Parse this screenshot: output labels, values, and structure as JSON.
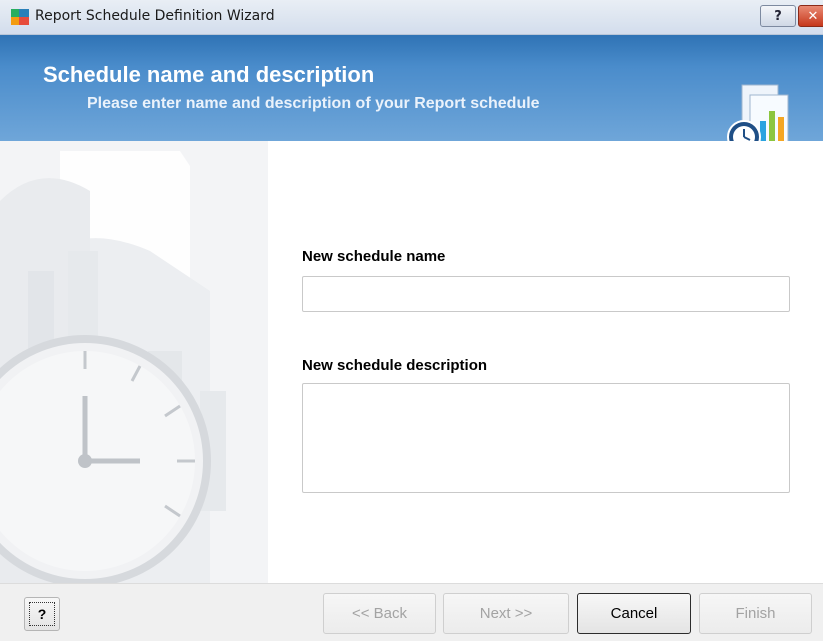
{
  "window": {
    "title": "Report Schedule Definition Wizard",
    "help_glyph": "?",
    "close_glyph": "✕"
  },
  "header": {
    "title": "Schedule name and description",
    "subtitle": "Please enter name and description of your Report schedule"
  },
  "form": {
    "name_label": "New schedule name",
    "name_value": "",
    "description_label": "New schedule description",
    "description_value": ""
  },
  "footer": {
    "help_label": "?",
    "back_label": "<< Back",
    "next_label": "Next >>",
    "cancel_label": "Cancel",
    "finish_label": "Finish"
  },
  "icons": {
    "app": "avg-app-icon",
    "header": "report-schedule-icon"
  },
  "colors": {
    "banner_top": "#2f73b5",
    "banner_bottom": "#6fa6d9",
    "close_button": "#c6381c"
  }
}
